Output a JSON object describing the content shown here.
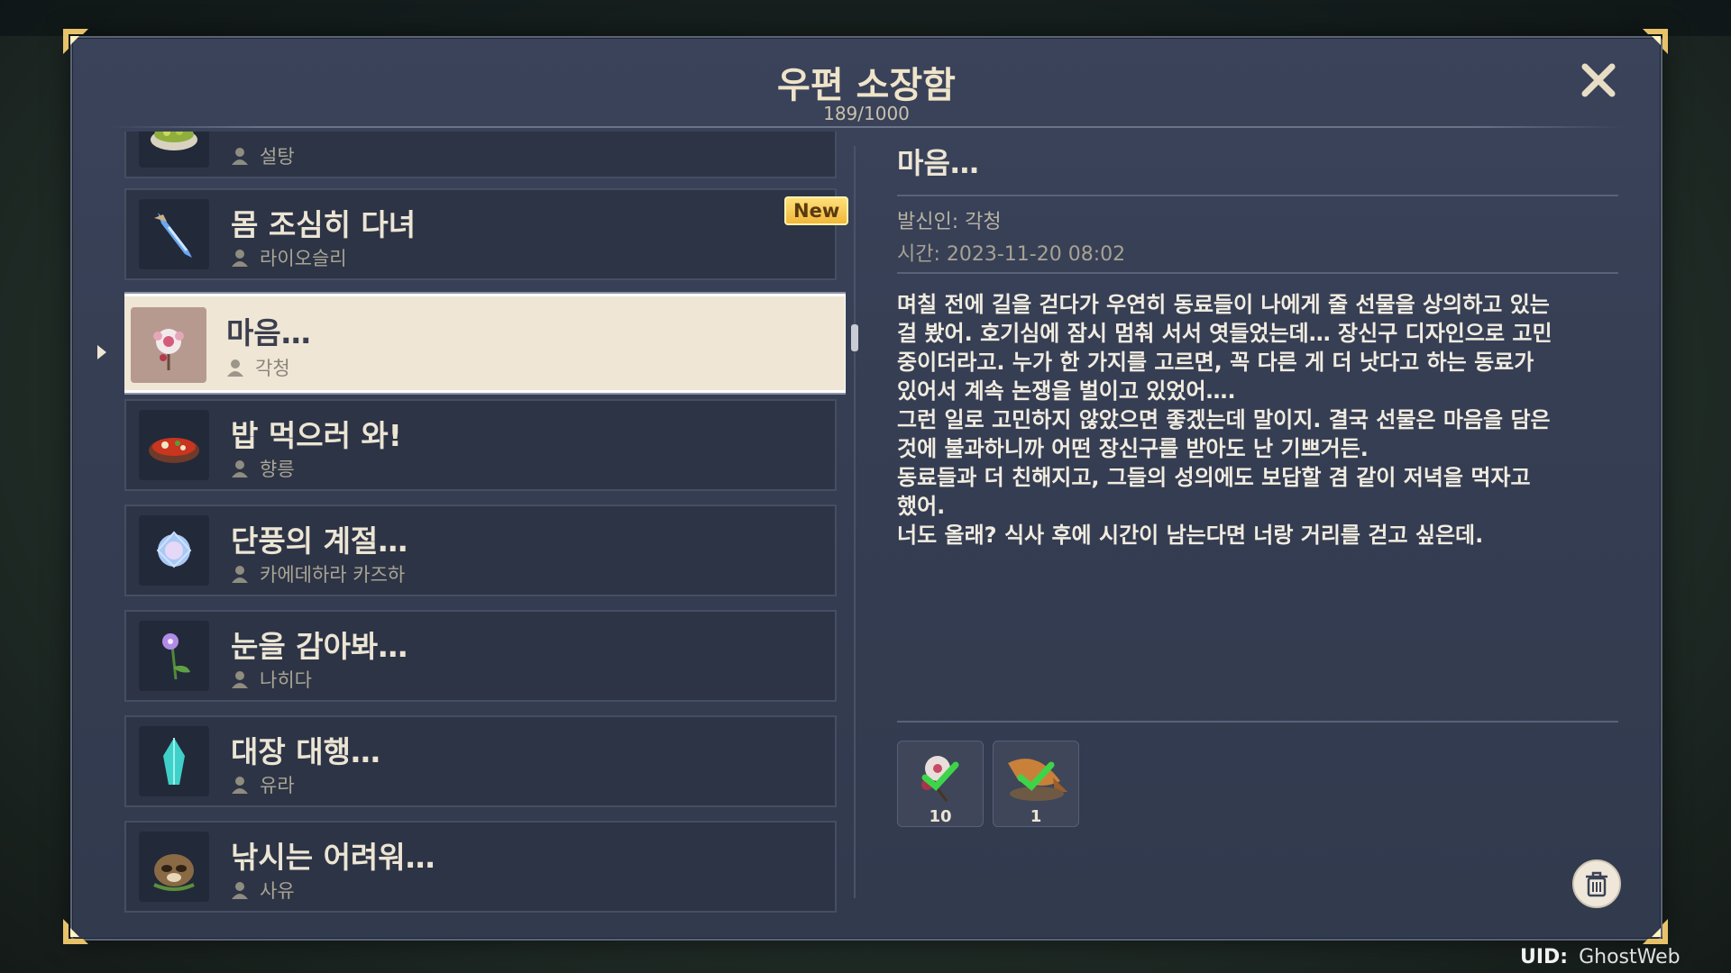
{
  "mailbox": {
    "title": "우편 소장함",
    "count": "189/1000",
    "close_icon": "close-icon"
  },
  "mail_list": [
    {
      "title": "",
      "sender": "설탕",
      "icon": "salad-bowl-icon"
    },
    {
      "title": "몸 조심히 다녀",
      "sender": "라이오슬리",
      "icon": "ice-dagger-icon",
      "is_new": true
    },
    {
      "title": "마음…",
      "sender": "각청",
      "icon": "flower-fan-icon",
      "selected": true
    },
    {
      "title": "밥 먹으러 와!",
      "sender": "향릉",
      "icon": "hotpot-icon"
    },
    {
      "title": "단풍의 계절…",
      "sender": "카에데하라 카즈하",
      "icon": "crystal-flower-icon"
    },
    {
      "title": "눈을 감아봐…",
      "sender": "나히다",
      "icon": "purple-flower-icon"
    },
    {
      "title": "대장 대행…",
      "sender": "유라",
      "icon": "ice-crystal-icon"
    },
    {
      "title": "낚시는 어려워…",
      "sender": "사유",
      "icon": "tanuki-icon"
    }
  ],
  "new_badge": "New",
  "detail": {
    "title": "마음…",
    "sender": "발신인: 각청",
    "time": "시간: 2023-11-20 08:02",
    "body": [
      "며칠 전에 길을 걷다가 우연히 동료들이 나에게 줄 선물을 상의하고 있는",
      "걸 봤어. 호기심에 잠시 멈춰 서서 엿들었는데… 장신구 디자인으로 고민",
      "중이더라고. 누가 한 가지를 고르면, 꼭 다른 게 더 낫다고 하는 동료가",
      "있어서 계속 논쟁을 벌이고 있었어….",
      "그런 일로 고민하지 않았으면 좋겠는데 말이지. 결국 선물은 마음을 담은",
      "것에 불과하니까 어떤 장신구를 받아도 난 기쁘거든.",
      "동료들과 더 친해지고, 그들의 성의에도 보답할 겸 같이 저녁을 먹자고",
      "했어.",
      "너도 올래? 식사 후에 시간이 남는다면 너랑 거리를 걷고 싶은데."
    ],
    "attachments": [
      {
        "icon": "flower-item-icon",
        "qty": "10",
        "claimed": true
      },
      {
        "icon": "fish-dish-icon",
        "qty": "1",
        "claimed": true
      }
    ]
  },
  "footer": {
    "uid_label": "UID:",
    "uid_value": "GhostWeb"
  }
}
